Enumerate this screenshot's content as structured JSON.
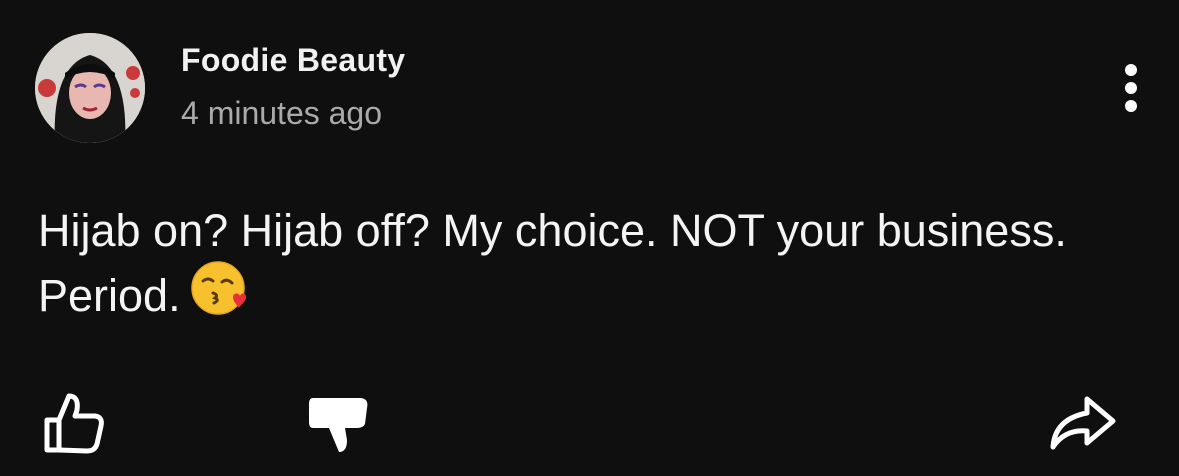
{
  "post": {
    "author": "Foodie Beauty",
    "timestamp": "4 minutes ago",
    "body_text": "Hijab on? Hijab off? My choice. NOT your business. Period.",
    "body_emoji": "kissing-face-with-heart-emoji",
    "avatar_icon": "author-avatar"
  },
  "header": {
    "more_icon": "more-vertical-icon"
  },
  "actions": {
    "like_icon": "thumbs-up-icon",
    "dislike_icon": "thumbs-down-icon",
    "share_icon": "share-icon"
  },
  "colors": {
    "background": "#0f0f0f",
    "text_primary": "#f4f4f4",
    "text_secondary": "#aaaaaa"
  }
}
